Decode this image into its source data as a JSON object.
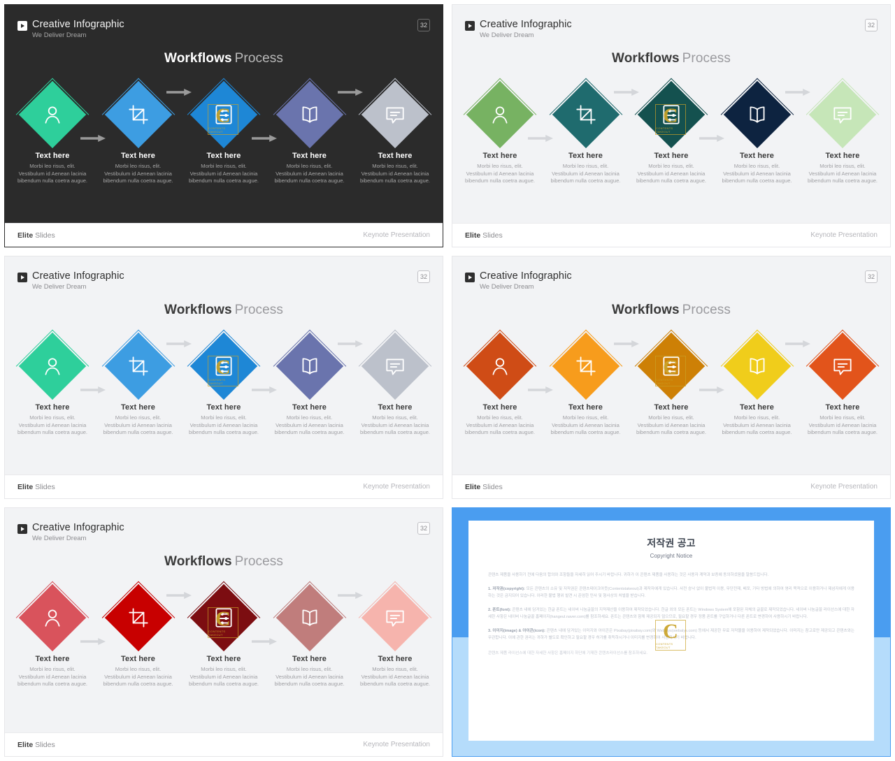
{
  "header": {
    "title": "Creative Infographic",
    "subtitle": "We Deliver Dream",
    "page_badge": "32",
    "play_icon": "play-icon"
  },
  "slide_title": {
    "bold": "Workflows",
    "light": "Process"
  },
  "footer": {
    "brand_bold": "Elite",
    "brand_light": "Slides",
    "right": "Keynote Presentation"
  },
  "steps": [
    {
      "icon": "user-icon",
      "title": "Text here",
      "body": "Morbi leo risus, elit. Vestibulum id Aenean lacinia bibendum nulla coetra augue."
    },
    {
      "icon": "crop-icon",
      "title": "Text here",
      "body": "Morbi leo risus, elit. Vestibulum id Aenean lacinia bibendum nulla coetra augue."
    },
    {
      "icon": "settings-list-icon",
      "title": "Text here",
      "body": "Morbi leo risus, elit. Vestibulum id Aenean lacinia bibendum nulla coetra augue."
    },
    {
      "icon": "book-icon",
      "title": "Text here",
      "body": "Morbi leo risus, elit. Vestibulum id Aenean lacinia bibendum nulla coetra augue."
    },
    {
      "icon": "chat-icon",
      "title": "Text here",
      "body": "Morbi leo risus, elit. Vestibulum id Aenean lacinia bibendum nulla coetra augue."
    }
  ],
  "palettes": {
    "slide1_teal_blue": [
      "#2ecf9b",
      "#3d9de2",
      "#1e87d6",
      "#6a74ad",
      "#bcc1cb"
    ],
    "slide2_green_navy": [
      "#77b262",
      "#1f6b6e",
      "#14514f",
      "#0d2340",
      "#c6e6b8"
    ],
    "slide3_teal_blue": [
      "#2ecf9b",
      "#3d9de2",
      "#1e87d6",
      "#6a74ad",
      "#bcc1cb"
    ],
    "slide4_orange": [
      "#cf4c16",
      "#f79c1c",
      "#cd8006",
      "#f0cd1b",
      "#e2541b"
    ],
    "slide5_red": [
      "#d9535c",
      "#c80000",
      "#7c0d11",
      "#c07d7c",
      "#f6b4ad"
    ]
  },
  "arrow_color_dark": "#9a9a9a",
  "arrow_color_light": "#d4d6da",
  "slides": [
    {
      "theme": "dark",
      "palette": "slide1_teal_blue",
      "watermark_on_step": 3
    },
    {
      "theme": "light",
      "palette": "slide2_green_navy",
      "watermark_on_step": 3
    },
    {
      "theme": "light",
      "palette": "slide3_teal_blue",
      "watermark_on_step": 3
    },
    {
      "theme": "light",
      "palette": "slide4_orange",
      "watermark_on_step": 3
    },
    {
      "theme": "light",
      "palette": "slide5_red",
      "watermark_on_step": 3
    }
  ],
  "watermark": {
    "letter": "C",
    "label": "CONTENTS TAKEOUT"
  },
  "copyright": {
    "title": "저작권 공고",
    "subtitle": "Copyright Notice",
    "intro": "콘텐츠 제품을 사용하기 전에 다음의 합의와 조항들을 자세히 읽어 주시기 바랍니다. 귀하가 이 콘텐츠 제품을 사용하는 것은 사용자 계약과 보증에 동의하셨음을 말씀드립니다.",
    "clause1_label": "1. 저작권(copyright):",
    "clause1": " 모든 콘텐츠의 소유 및 저작권은 콘텐츠테이크아웃(Contentstakeout)과 제작자에게 있습니다. 사전 승낙 없이 불법적 이용, 무단전재, 배포, 기타 방법에 의하여 영리 목적으로 이용하거나 제삼자에게 이용하는 것은 금지되어 있습니다. 이러한 불법 행위 발견 시 준엄한 민사 및 형사상의 처벌을 받습니다.",
    "clause2_label": "2. 폰트(font):",
    "clause2": " 콘텐츠 내에 담겨있는 한글 폰트는 네이버 나눔글꼴의 지적재산을 이용하여 제작되었습니다. 한글 외의 모든 폰트는 Windows System에 포함된 자체의 글꼴로 제작되었습니다. 네이버 나눔글꼴 라이선스에 대한 자세한 사항은 네이버 나눔글꼴 홈페이지(hangeul.naver.com)를 참조하세요. 폰트는 콘텐츠와 함께 제공되지 않으므로, 필요할 경우 정품 폰트를 구입하거나 다른 폰트로 변경하여 사용하시기 바랍니다.",
    "clause3_label": "3. 이미지(image) & 아이콘(icon):",
    "clause3": " 콘텐츠 내에 담겨있는 이미지와 아이콘은 Pixabay(pixabay.com)와 Webalys(webalys.com) 등에서 제공한 무료 저작물을 이용하여 제작되었습니다. 이미지는 참고로만 제공되고 콘텐츠와는 무관합니다. 이에 관한 권리는 귀하가 별도로 확인하고 필요할 경우 허가를 취득하시거나 이미지를 변경하여 사용하시기 바랍니다.",
    "closing": "콘텐츠 제품 라이선스에 대한 자세한 사항은 홈페이지 하단에 기재한 콘텐츠라이선스를 참조하세요."
  }
}
